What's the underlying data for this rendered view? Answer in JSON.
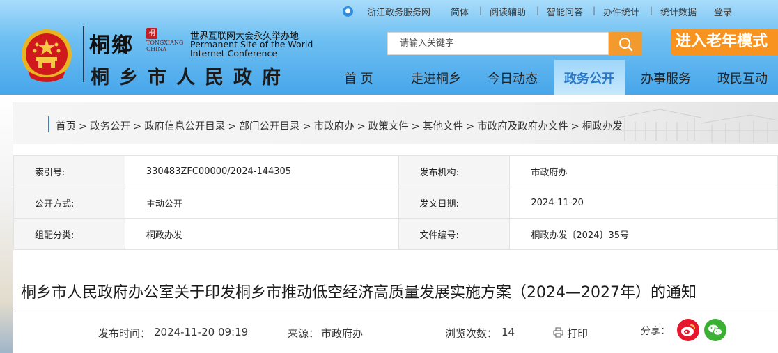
{
  "topbar": {
    "gov_service": "浙江政务服务网",
    "links": [
      "简体",
      "阅读辅助",
      "智能问答",
      "办件统计",
      "统计数据",
      "登录"
    ],
    "separator": "|"
  },
  "brand": {
    "calligraphy": "桐鄉",
    "seal_char": "桐",
    "latin_line1": "TONGXIANG",
    "latin_line2": "CHINA",
    "wic_cn": "世界互联网大会永久举办地",
    "wic_en": "Permanent Site of the World Internet Conference",
    "site_name": "桐乡市人民政府"
  },
  "search": {
    "placeholder": "请输入关键字"
  },
  "elder_mode": "进入老年模式",
  "nav": {
    "items": [
      "首 页",
      "走进桐乡",
      "今日动态",
      "政务公开",
      "办事服务",
      "政民互动"
    ],
    "active": "政务公开"
  },
  "breadcrumb": {
    "items": [
      "首页",
      "政务公开",
      "政府信息公开目录",
      "部门公开目录",
      "市政府办",
      "政策文件",
      "其他文件",
      "市政府及政府办文件",
      "桐政办发"
    ],
    "separator": ">"
  },
  "info": {
    "rows": [
      [
        "索引号:",
        "330483ZFC00000/2024-144305",
        "发布机构:",
        "市政府办"
      ],
      [
        "公开方式:",
        "主动公开",
        "发文日期:",
        "2024-11-20"
      ],
      [
        "组配分类:",
        "桐政办发",
        "文件编号:",
        "桐政办发〔2024〕35号"
      ]
    ]
  },
  "doc": {
    "title": "桐乡市人民政府办公室关于印发桐乡市推动低空经济高质量发展实施方案（2024—2027年）的通知"
  },
  "meta": {
    "publish_label": "发布时间：",
    "publish_time": "2024-11-20  09:19",
    "source_label": "来源：",
    "source": "市政府办",
    "views_label": "浏览次数：",
    "views": "14",
    "print": "打印",
    "share_label": "分享："
  },
  "colors": {
    "header_blue": "#47a6ea",
    "accent_orange": "#f7931e",
    "nav_active_text": "#2878c8",
    "weibo_red": "#e6162d",
    "wechat_green": "#3cb034"
  }
}
